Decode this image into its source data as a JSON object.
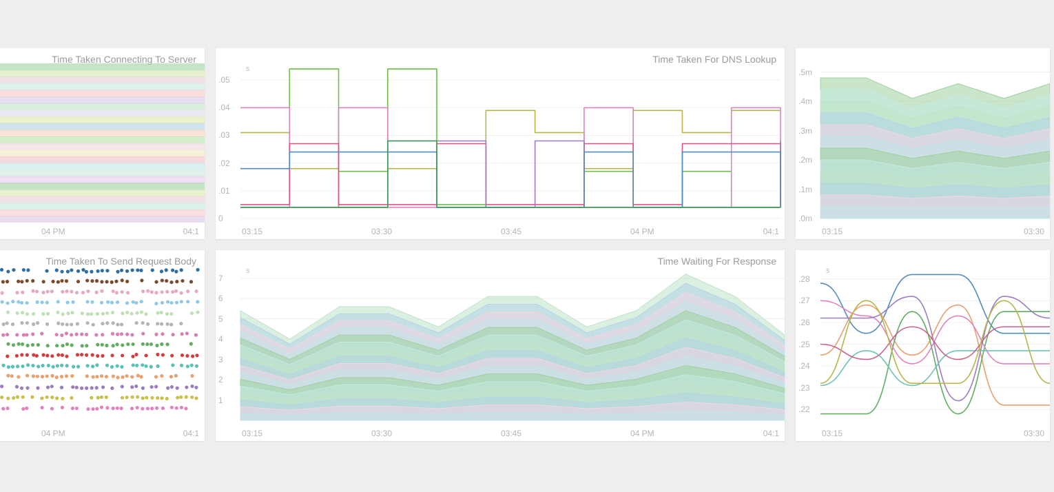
{
  "panels": {
    "tl": {
      "title": "Time Taken Connecting To Server",
      "xticks": [
        "04 PM",
        "04:1"
      ],
      "partial_left": true
    },
    "tm": {
      "title": "Time Taken For DNS Lookup",
      "xticks": [
        "03:15",
        "03:30",
        "03:45",
        "04 PM",
        "04:1"
      ],
      "y_unit": "s"
    },
    "tr": {
      "title_visible": false,
      "xticks": [
        "03:15",
        "03:30"
      ],
      "y_unit": "m",
      "partial_right": true
    },
    "bl": {
      "title": "Time Taken To Send Request Body",
      "xticks": [
        "04 PM",
        "04:1"
      ],
      "partial_left": true
    },
    "bm": {
      "title": "Time Waiting For Response",
      "xticks": [
        "03:15",
        "03:30",
        "03:45",
        "04 PM",
        "04:1"
      ],
      "y_unit": "s"
    },
    "br": {
      "title_visible": false,
      "xticks": [
        "03:15",
        "03:30"
      ],
      "y_unit": "s",
      "partial_right": true
    }
  },
  "palette": [
    "#9ed19e",
    "#b4e2a7",
    "#f7c6c6",
    "#c1e6e8",
    "#e0e6a8",
    "#d7e8b0",
    "#f3d6e4",
    "#d6c8e6",
    "#cfe7db",
    "#b3d4e8",
    "#e8cfd7",
    "#f0e9bf",
    "#bfe3c8",
    "#e4cbe9",
    "#f4d0ba",
    "#c5eae0",
    "#edc2c4",
    "#dcdae8"
  ],
  "chart_data": [
    {
      "id": "tm",
      "type": "line",
      "title": "Time Taken For DNS Lookup",
      "xlabel": "",
      "ylabel": "s",
      "ylim": [
        0,
        0.055
      ],
      "x": [
        "03:15",
        "03:20",
        "03:25",
        "03:30",
        "03:35",
        "03:40",
        "03:45",
        "03:50",
        "03:55",
        "04:00",
        "04:05",
        "04:10"
      ],
      "yticks": [
        0,
        0.01,
        0.02,
        0.03,
        0.04,
        0.05
      ],
      "series": [
        {
          "name": "s1-green",
          "color": "#6cbf47",
          "values": [
            0.004,
            0.054,
            0.017,
            0.054,
            0.005,
            0.004,
            0.004,
            0.017,
            0.004,
            0.017,
            0.004,
            0.004
          ]
        },
        {
          "name": "s2-olive",
          "color": "#b7b54a",
          "values": [
            0.031,
            0.018,
            0.004,
            0.018,
            0.004,
            0.039,
            0.031,
            0.018,
            0.039,
            0.031,
            0.039,
            0.039
          ]
        },
        {
          "name": "s3-pink",
          "color": "#e382bf",
          "values": [
            0.04,
            0.004,
            0.04,
            0.004,
            0.004,
            0.004,
            0.004,
            0.04,
            0.004,
            0.004,
            0.04,
            0.004
          ]
        },
        {
          "name": "s4-magenta",
          "color": "#e05087",
          "values": [
            0.005,
            0.027,
            0.005,
            0.005,
            0.027,
            0.005,
            0.005,
            0.027,
            0.005,
            0.027,
            0.027,
            0.005
          ]
        },
        {
          "name": "s5-purple",
          "color": "#9b7cc2",
          "values": [
            0.004,
            0.004,
            0.004,
            0.028,
            0.028,
            0.004,
            0.028,
            0.004,
            0.004,
            0.004,
            0.004,
            0.028
          ]
        },
        {
          "name": "s6-blue",
          "color": "#4f8cbf",
          "values": [
            0.018,
            0.024,
            0.024,
            0.024,
            0.004,
            0.004,
            0.004,
            0.024,
            0.004,
            0.024,
            0.024,
            0.004
          ]
        },
        {
          "name": "s7-dkgreen",
          "color": "#3f9f56",
          "values": [
            0.004,
            0.004,
            0.004,
            0.028,
            0.004,
            0.004,
            0.004,
            0.004,
            0.004,
            0.004,
            0.004,
            0.004
          ]
        }
      ]
    },
    {
      "id": "bm",
      "type": "area",
      "title": "Time Waiting For Response",
      "xlabel": "",
      "ylabel": "s",
      "ylim": [
        0,
        7.5
      ],
      "x": [
        "03:15",
        "03:20",
        "03:25",
        "03:30",
        "03:35",
        "03:40",
        "03:45",
        "03:50",
        "03:55",
        "04:00",
        "04:05",
        "04:10"
      ],
      "yticks": [
        1,
        2,
        3,
        4,
        5,
        6,
        7
      ],
      "stack_top": [
        5.4,
        4.0,
        5.6,
        5.6,
        4.6,
        6.1,
        6.1,
        4.6,
        5.4,
        7.2,
        6.1,
        4.2
      ],
      "stack_bands": 16
    },
    {
      "id": "tr",
      "type": "area",
      "xlabel": "",
      "ylabel": "m",
      "ylim": [
        0,
        0.52
      ],
      "x": [
        "03:15",
        "03:20",
        "03:25",
        "03:30",
        "03:35",
        "03:40"
      ],
      "yticks": [
        0,
        0.1,
        0.2,
        0.3,
        0.4,
        0.5
      ],
      "stack_top": [
        0.48,
        0.48,
        0.41,
        0.46,
        0.41,
        0.46
      ],
      "stack_bands": 12
    },
    {
      "id": "br",
      "type": "line",
      "xlabel": "",
      "ylabel": "s",
      "ylim": [
        0.215,
        0.285
      ],
      "x": [
        "03:15",
        "03:20",
        "03:25",
        "03:30",
        "03:35",
        "03:40"
      ],
      "yticks": [
        0.22,
        0.23,
        0.24,
        0.25,
        0.26,
        0.27,
        0.28
      ],
      "series": [
        {
          "name": "l1-blue",
          "color": "#4f8cbf",
          "values": [
            0.278,
            0.255,
            0.282,
            0.282,
            0.255,
            0.255
          ]
        },
        {
          "name": "l2-orange",
          "color": "#e8a06c",
          "values": [
            0.245,
            0.268,
            0.245,
            0.268,
            0.222,
            0.222
          ]
        },
        {
          "name": "l3-green",
          "color": "#5fae5f",
          "values": [
            0.218,
            0.218,
            0.265,
            0.218,
            0.265,
            0.265
          ]
        },
        {
          "name": "l4-pink",
          "color": "#e382bf",
          "values": [
            0.27,
            0.263,
            0.241,
            0.263,
            0.241,
            0.241
          ]
        },
        {
          "name": "l5-purple",
          "color": "#9b7cc2",
          "values": [
            0.262,
            0.262,
            0.272,
            0.224,
            0.272,
            0.262
          ]
        },
        {
          "name": "l6-teal",
          "color": "#6fc1b8",
          "values": [
            0.231,
            0.247,
            0.231,
            0.247,
            0.247,
            0.247
          ]
        },
        {
          "name": "l7-mag",
          "color": "#cc5f8f",
          "values": [
            0.25,
            0.243,
            0.258,
            0.243,
            0.258,
            0.258
          ]
        },
        {
          "name": "l8-olive",
          "color": "#b7b54a",
          "values": [
            0.232,
            0.27,
            0.232,
            0.232,
            0.27,
            0.232
          ]
        }
      ]
    },
    {
      "id": "tl",
      "type": "area",
      "title": "Time Taken Connecting To Server",
      "stack_bands": 24,
      "note": "panel is left-clipped; no y-axis visible"
    },
    {
      "id": "bl",
      "type": "scatter",
      "title": "Time Taken To Send Request Body",
      "note": "panel is left-clipped; discrete dot rows per series"
    }
  ]
}
